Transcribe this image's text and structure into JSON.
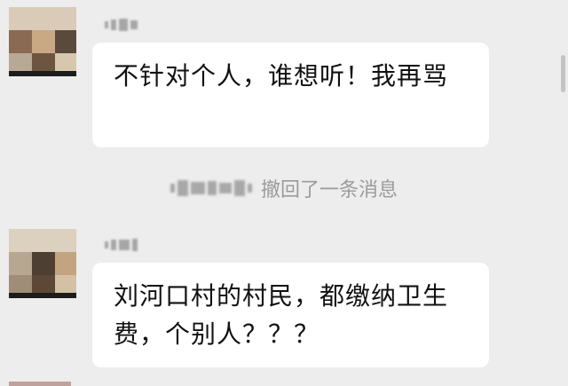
{
  "messages": [
    {
      "text": "不针对个人，谁想听！我再骂"
    },
    {
      "text": "刘河口村的村民，都缴纳卫生费，个别人？？？"
    }
  ],
  "system_notice": {
    "recall_text": "撤回了一条消息"
  },
  "colors": {
    "background": "#ededed",
    "bubble": "#ffffff",
    "notice_text": "#9b9b9b"
  }
}
